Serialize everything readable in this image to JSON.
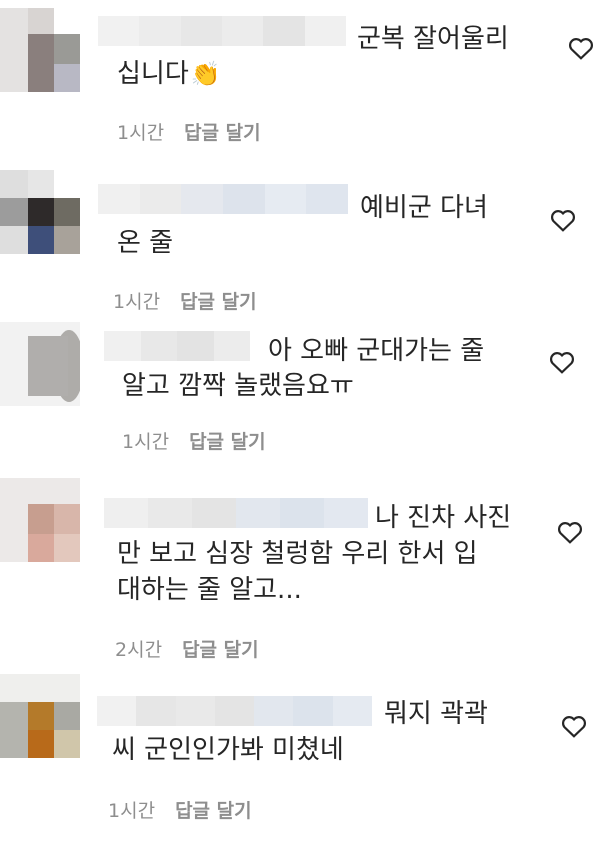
{
  "comments": [
    {
      "lines": [
        "군복 잘어울리",
        "십니다"
      ],
      "emoji": "👏",
      "time": "1시간",
      "reply": "답글 달기",
      "avatar_colors": [
        "#c8c3c1",
        "#8a7f7d",
        "#9a9a96",
        "#a09895",
        "#7e7572",
        "#b8b8c4"
      ]
    },
    {
      "lines": [
        "예비군 다녀",
        "온 줄"
      ],
      "emoji": "",
      "time": "1시간",
      "reply": "답글 달기",
      "avatar_colors": [
        "#d0d0d0",
        "#2e2a2a",
        "#6e6b62",
        "#8b8b8b",
        "#3e4f7a",
        "#a8a29a"
      ]
    },
    {
      "lines": [
        "아 오빠 군대가는 줄",
        "알고 깜짝 놀랬음요ㅠ"
      ],
      "emoji": "",
      "time": "1시간",
      "reply": "답글 달기",
      "avatar_colors": [
        "#f2f2f2",
        "#b0aeac",
        "#aaa8a4",
        "#e8e8e8",
        "#b2b0ad",
        "#e0e0e0"
      ]
    },
    {
      "lines": [
        "나 진차 사진",
        "만 보고 심장 철렁함 우리 한서 입",
        "대하는 줄 알고..."
      ],
      "emoji": "",
      "time": "2시간",
      "reply": "답글 달기",
      "avatar_colors": [
        "#e0dcda",
        "#c7a394",
        "#d1b2a6",
        "#d6c7c2",
        "#d7a79a",
        "#e3c8bd"
      ]
    },
    {
      "lines": [
        "뭐지 곽곽",
        "씨 군인인가봐 미쳤네"
      ],
      "emoji": "",
      "time": "1시간",
      "reply": "답글 달기",
      "avatar_colors": [
        "#c8c8c4",
        "#b47a2a",
        "#a9a9a3",
        "#a8a8a0",
        "#b86a1a",
        "#c8c0a8"
      ]
    }
  ]
}
